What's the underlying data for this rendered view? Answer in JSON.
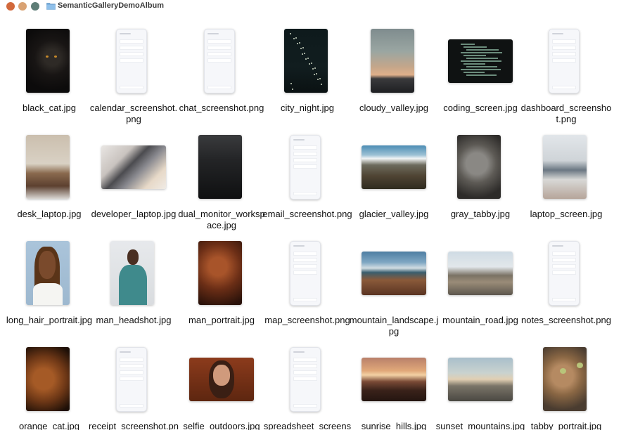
{
  "window": {
    "title": "SemanticGalleryDemoAlbum",
    "traffic_lights": {
      "close": "#d2693c",
      "minimize": "#d9a273",
      "zoom": "#5e7d77"
    },
    "folder_icon": "folder-icon"
  },
  "files": [
    {
      "name": "black_cat.jpg",
      "kind": "photo",
      "art": "black-cat"
    },
    {
      "name": "calendar_screenshot.png",
      "kind": "screenshot",
      "art": "calendar"
    },
    {
      "name": "chat_screenshot.png",
      "kind": "screenshot",
      "art": "chat"
    },
    {
      "name": "city_night.jpg",
      "kind": "photo",
      "art": "city"
    },
    {
      "name": "cloudy_valley.jpg",
      "kind": "photo",
      "art": "cloudy"
    },
    {
      "name": "coding_screen.jpg",
      "kind": "photo",
      "art": "coding"
    },
    {
      "name": "dashboard_screenshot.png",
      "kind": "screenshot",
      "art": "dashboard"
    },
    {
      "name": "desk_laptop.jpg",
      "kind": "photo",
      "art": "desk"
    },
    {
      "name": "developer_laptop.jpg",
      "kind": "photo",
      "art": "devlap"
    },
    {
      "name": "dual_monitor_workspace.jpg",
      "kind": "photo",
      "art": "dual"
    },
    {
      "name": "email_screenshot.png",
      "kind": "screenshot",
      "art": "email"
    },
    {
      "name": "glacier_valley.jpg",
      "kind": "photo",
      "art": "glacier"
    },
    {
      "name": "gray_tabby.jpg",
      "kind": "photo",
      "art": "tabby"
    },
    {
      "name": "laptop_screen.jpg",
      "kind": "photo",
      "art": "lapscr"
    },
    {
      "name": "long_hair_portrait.jpg",
      "kind": "photo",
      "art": "longhair"
    },
    {
      "name": "man_headshot.jpg",
      "kind": "photo",
      "art": "manhead"
    },
    {
      "name": "man_portrait.jpg",
      "kind": "photo",
      "art": "manportrait"
    },
    {
      "name": "map_screenshot.png",
      "kind": "screenshot",
      "art": "map"
    },
    {
      "name": "mountain_landscape.jpg",
      "kind": "photo",
      "art": "mtnland"
    },
    {
      "name": "mountain_road.jpg",
      "kind": "photo",
      "art": "mtnroad"
    },
    {
      "name": "notes_screenshot.png",
      "kind": "screenshot",
      "art": "notes"
    },
    {
      "name": "orange_cat.jpg",
      "kind": "photo",
      "art": "orangecat"
    },
    {
      "name": "receipt_screenshot.png",
      "kind": "screenshot",
      "art": "receipt"
    },
    {
      "name": "selfie_outdoors.jpg",
      "kind": "photo",
      "art": "selfie"
    },
    {
      "name": "spreadsheet_screenshot.png",
      "kind": "screenshot",
      "art": "spreadsheet"
    },
    {
      "name": "sunrise_hills.jpg",
      "kind": "photo",
      "art": "sunrise"
    },
    {
      "name": "sunset_mountains.jpg",
      "kind": "photo",
      "art": "sunset"
    },
    {
      "name": "tabby_portrait.jpg",
      "kind": "photo",
      "art": "tabbyportrait"
    }
  ]
}
